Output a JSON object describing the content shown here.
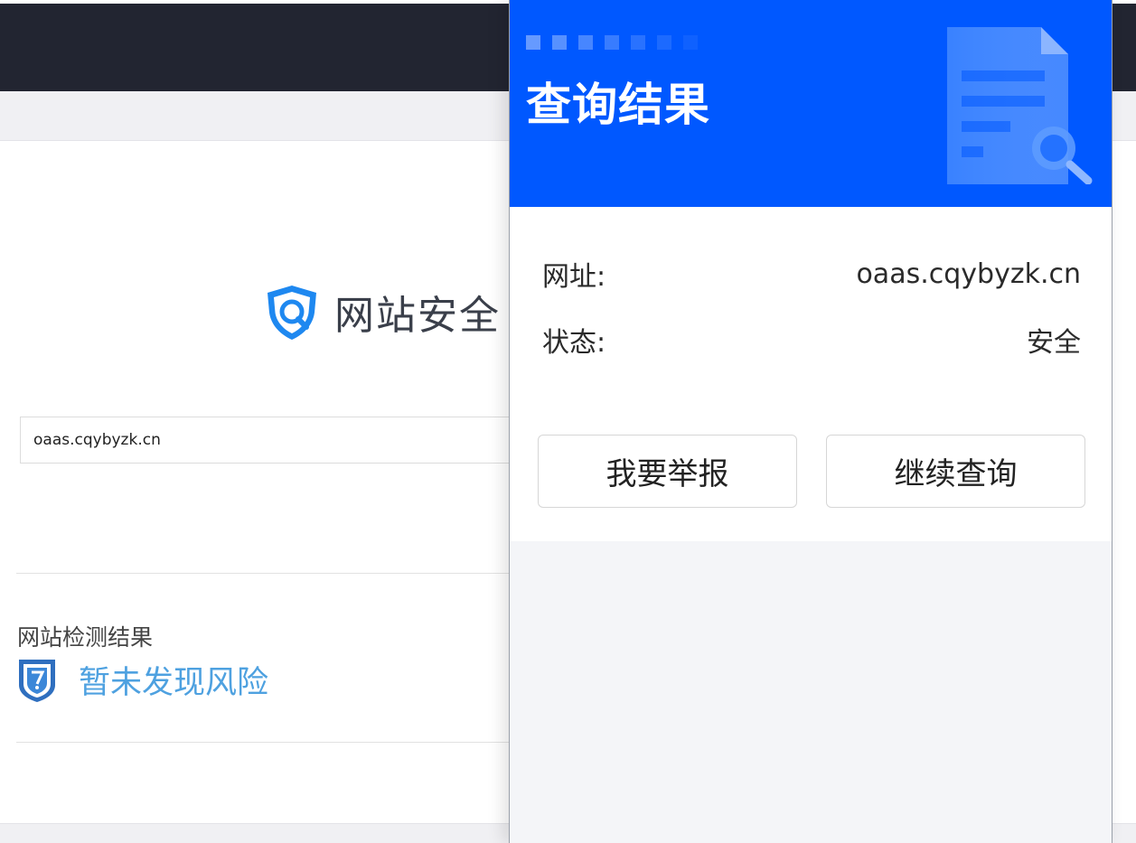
{
  "site": {
    "brand_title": "网站安全",
    "search_value": "oaas.cqybyzk.cn",
    "result_label": "网站检测结果",
    "result_text": "暂未发现风险"
  },
  "panel": {
    "title": "查询结果",
    "url_label": "网址:",
    "url_value": "oaas.cqybyzk.cn",
    "status_label": "状态:",
    "status_value": "安全",
    "report_button": "我要举报",
    "continue_button": "继续查询"
  },
  "colors": {
    "header_blue": "#0058ff",
    "topbar_dark": "#222531",
    "result_blue": "#4ea1e0",
    "brand_icon_blue": "#1e88f0"
  },
  "icons": {
    "brand": "shield-search-icon",
    "result": "shield-check-icon",
    "header_art": "document-search-icon"
  }
}
